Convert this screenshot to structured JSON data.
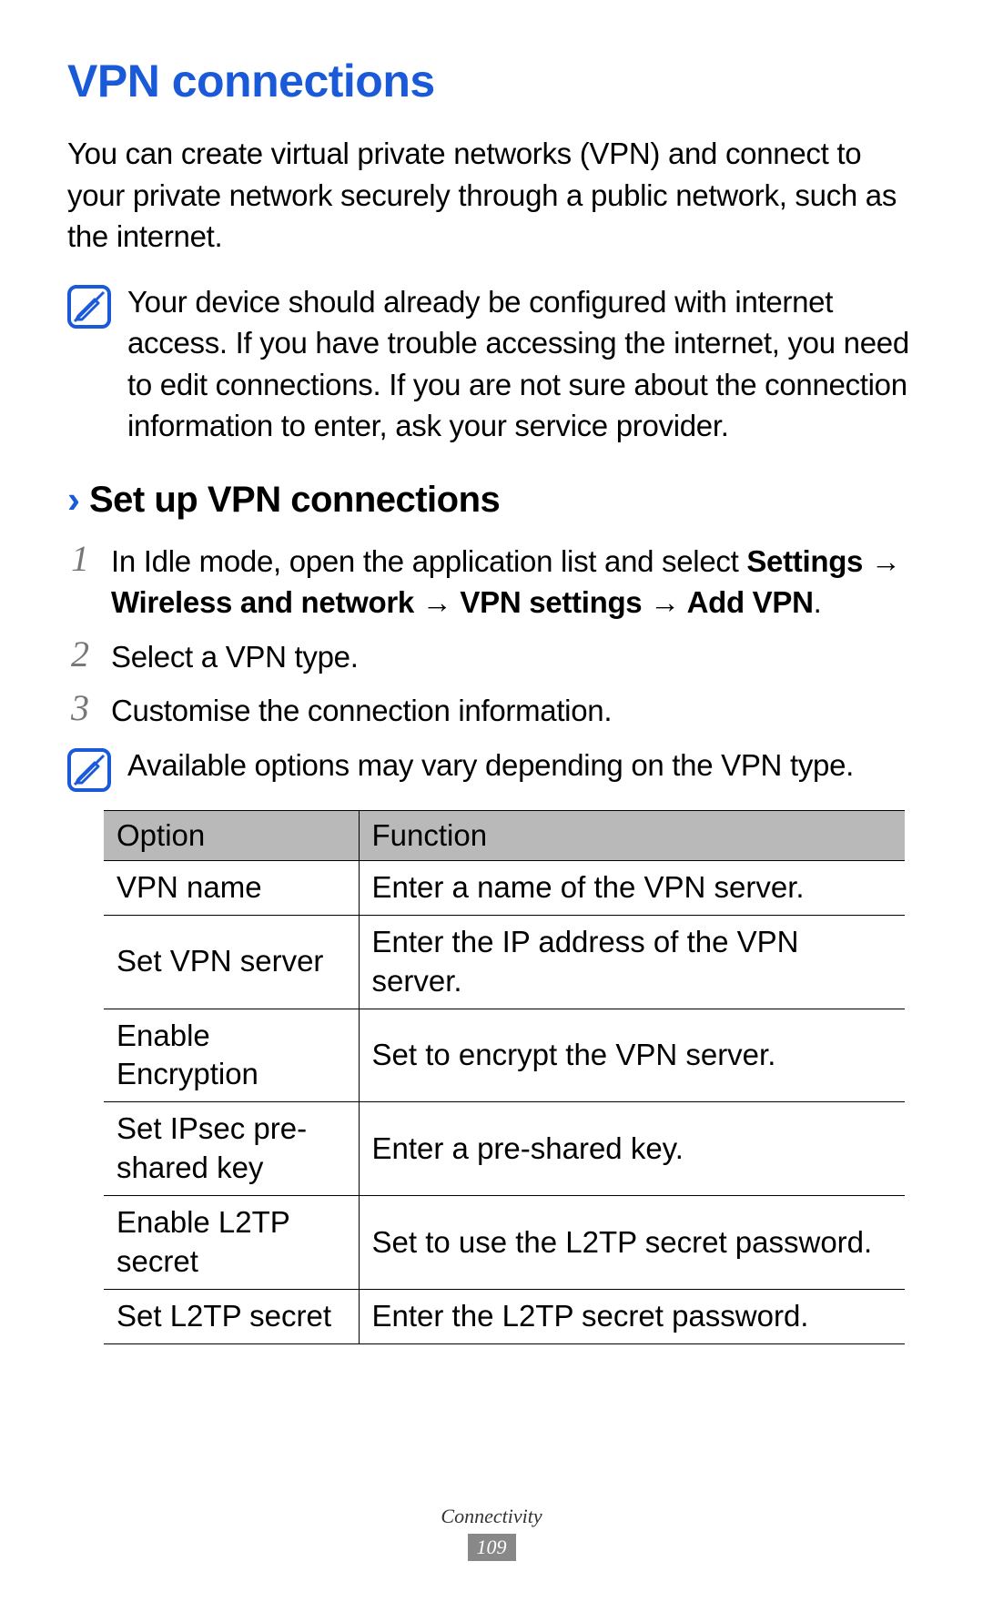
{
  "heading": "VPN connections",
  "intro": "You can create virtual private networks (VPN) and connect to your private network securely through a public network, such as the internet.",
  "note1": "Your device should already be configured with internet access. If you have trouble accessing the internet, you need to edit connections. If you are not sure about the connection information to enter, ask your service provider.",
  "subheading": "Set up VPN connections",
  "steps": {
    "s1a": "In Idle mode, open the application list and select ",
    "s1b": "Settings → Wireless and network → VPN settings → Add VPN",
    "s1c": ".",
    "s2": "Select a VPN type.",
    "s3": "Customise the connection information."
  },
  "note2": "Available options may vary depending on the VPN type.",
  "table": {
    "header_option": "Option",
    "header_function": "Function",
    "rows": [
      {
        "option": "VPN name",
        "function": "Enter a name of the VPN server."
      },
      {
        "option": "Set VPN server",
        "function": "Enter the IP address of the VPN server."
      },
      {
        "option": "Enable Encryption",
        "function": "Set to encrypt the VPN server."
      },
      {
        "option": "Set IPsec pre-shared key",
        "function": "Enter a pre-shared key."
      },
      {
        "option": "Enable L2TP secret",
        "function": "Set to use the L2TP secret password."
      },
      {
        "option": "Set L2TP secret",
        "function": "Enter the L2TP secret password."
      }
    ]
  },
  "footer": {
    "section": "Connectivity",
    "page": "109"
  },
  "nums": {
    "n1": "1",
    "n2": "2",
    "n3": "3"
  }
}
